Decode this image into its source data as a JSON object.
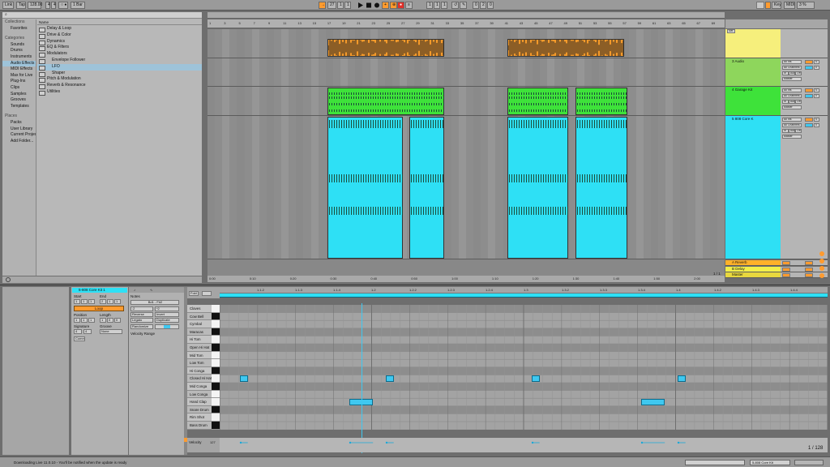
{
  "toolbar": {
    "link": "Link",
    "tap": "Tap",
    "tempo": "128.00",
    "sig_num": "4",
    "sig_den": "4",
    "metro": "○ ●",
    "quant": "1 Bar",
    "pos": "27",
    "pos2": "1",
    "pos3": "1",
    "loop1": "1",
    "loop2": "1",
    "loop3": "1",
    "len1": "0",
    "len2": "2",
    "len3": "0",
    "key": "Key",
    "midi": "MIDI",
    "cpu": "3 %"
  },
  "browser": {
    "search_placeholder": "",
    "sections": {
      "collections": "Collections",
      "categories": "Categories",
      "places": "Places",
      "name_header": "Name"
    },
    "collections": [
      "Favorites"
    ],
    "categories": [
      "Sounds",
      "Drums",
      "Instruments",
      "Audio Effects",
      "MIDI Effects",
      "Max for Live",
      "Plug-Ins",
      "Clips",
      "Samples",
      "Grooves",
      "Templates"
    ],
    "places": [
      "Packs",
      "User Library",
      "Current Project",
      "Add Folder..."
    ],
    "folders": [
      {
        "name": "Delay & Loop",
        "level": 0,
        "selected": false
      },
      {
        "name": "Drive & Color",
        "level": 0,
        "selected": false
      },
      {
        "name": "Dynamics",
        "level": 0,
        "selected": false
      },
      {
        "name": "EQ & Filters",
        "level": 0,
        "selected": false
      },
      {
        "name": "Modulators",
        "level": 0,
        "selected": false,
        "open": true
      },
      {
        "name": "Envelope Follower",
        "level": 1,
        "selected": false
      },
      {
        "name": "LFO",
        "level": 1,
        "selected": true
      },
      {
        "name": "Shaper",
        "level": 1,
        "selected": false
      },
      {
        "name": "Pitch & Modulation",
        "level": 0,
        "selected": false
      },
      {
        "name": "Reverb & Resonance",
        "level": 0,
        "selected": false
      },
      {
        "name": "Utilities",
        "level": 0,
        "selected": false
      }
    ]
  },
  "arrangement": {
    "bars": [
      "1",
      "3",
      "5",
      "7",
      "9",
      "11",
      "13",
      "15",
      "17",
      "19",
      "21",
      "23",
      "25",
      "27",
      "29",
      "31",
      "33",
      "35",
      "37",
      "39",
      "41",
      "43",
      "45",
      "47",
      "49",
      "51",
      "53",
      "55",
      "57",
      "59",
      "61",
      "63",
      "65",
      "67",
      "69"
    ],
    "time_ticks": [
      "0:00",
      "0:10",
      "0:20",
      "0:30",
      "0:40",
      "0:50",
      "1:00",
      "1:10",
      "1:20",
      "1:30",
      "1:40",
      "1:50",
      "2:00"
    ],
    "tracks": [
      {
        "name": "",
        "color": "#f6ef7c"
      },
      {
        "name": "3 Audio",
        "color": "#8ed65c"
      },
      {
        "name": "4 Garage Kit",
        "color": "#3ee23a"
      },
      {
        "name": "5 808 Core K",
        "color": "#2ee0f5"
      }
    ],
    "returns": [
      {
        "name": "A Reverb",
        "color": "#ffb129"
      },
      {
        "name": "B Delay",
        "color": "#f2ef4a"
      }
    ],
    "master": {
      "name": "Master",
      "color": "#e8d83e"
    },
    "set_label": "Set",
    "page": "1 / 1",
    "mixer_labels": {
      "all_ins": "All Ins",
      "ch1": "1",
      "in": "In",
      "auto": "Auto",
      "off": "Off",
      "master": "Master",
      "ext_in": "Ext. In",
      "all_chan": "All Channels",
      "s": "S",
      "a": "A",
      "b": "B",
      "c": "C",
      "zero": "0"
    },
    "colors": {
      "orange": "#f59a2a",
      "green": "#3ee23a",
      "cyan": "#2ee0f5"
    }
  },
  "clip_view": {
    "title": "5-808 Core Kit 1",
    "start_label": "Start",
    "end_label": "End",
    "loop_btn": "Loop",
    "position_label": "Position",
    "length_label": "Length",
    "signature_label": "Signature",
    "groove_label": "Groove",
    "none": "None",
    "commit": "Commit",
    "notes_label": "Notes",
    "range": "Bd1 - F#2",
    "reverse": "Reverse",
    "invert": "Invert",
    "legato": "Legato",
    "duplicate": "Duplicate",
    "randomize": "Randomize",
    "velocity_range": "Velocity Range",
    "fold": "Fold",
    "start_vals": [
      "1",
      "1",
      "1"
    ],
    "end_vals": [
      "2",
      "1",
      "1"
    ],
    "pos_vals": [
      "1",
      "1",
      "1"
    ],
    "len_vals": [
      "1",
      "0",
      "0"
    ],
    "sig_vals": [
      "4",
      "4"
    ],
    "velocity_label": "Velocity",
    "velocity_max": "127",
    "zoom": "1 / 128"
  },
  "piano_roll": {
    "ruler": [
      "1.1.2",
      "1.1.3",
      "1.1.4",
      "1.2",
      "1.2.2",
      "1.2.3",
      "1.2.4",
      "1.3",
      "1.3.2",
      "1.3.3",
      "1.3.4",
      "1.4",
      "1.4.2",
      "1.4.3",
      "1.4.4"
    ],
    "drums": [
      "Claves",
      "Cow Bell",
      "Cymbal",
      "Maracas",
      "Hi Tom",
      "Open Hi Hat",
      "Mid Tom",
      "Low Tom",
      "Hi Conga",
      "Closed Hi Hat",
      "Mid Conga",
      "Low Conga",
      "Hand Clap",
      "Snare Drum",
      "Rim Shot",
      "Bass Drum"
    ],
    "notes": [
      {
        "row": 9,
        "start": 0.25,
        "len": 0.03
      },
      {
        "row": 9,
        "start": 1.25,
        "len": 0.03
      },
      {
        "row": 9,
        "start": 2.25,
        "len": 0.03
      },
      {
        "row": 9,
        "start": 3.25,
        "len": 0.03
      },
      {
        "row": 12,
        "start": 1.0,
        "len": 0.09
      },
      {
        "row": 12,
        "start": 3.0,
        "len": 0.09
      }
    ]
  },
  "status": {
    "message": "Downloading Live 11.0.10 - You'll be notified when the update is ready",
    "track": "5-808 Core Kit"
  }
}
